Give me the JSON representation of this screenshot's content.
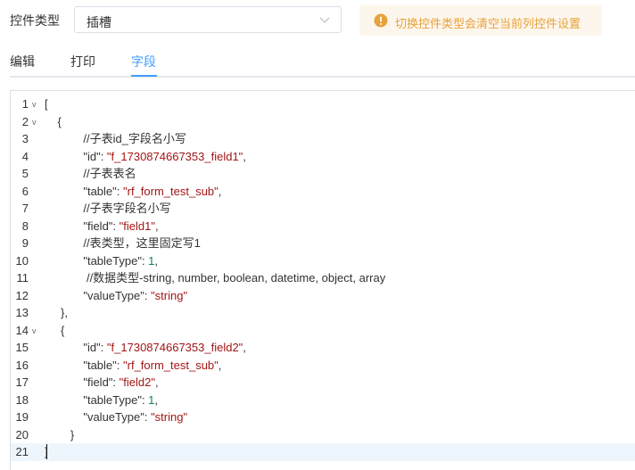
{
  "form": {
    "control_type_label": "控件类型",
    "control_type_value": "插槽",
    "warning_text": "切换控件类型会清空当前列控件设置"
  },
  "tabs": [
    {
      "label": "编辑",
      "active": false
    },
    {
      "label": "打印",
      "active": false
    },
    {
      "label": "字段",
      "active": true
    }
  ],
  "editor": {
    "active_line": 21,
    "lines": [
      {
        "n": "1",
        "fold": true,
        "tokens": [
          {
            "t": "[",
            "k": "p"
          }
        ]
      },
      {
        "n": "2",
        "fold": true,
        "tokens": [
          {
            "t": "    {",
            "k": "p"
          }
        ]
      },
      {
        "n": "3",
        "fold": false,
        "tokens": [
          {
            "t": "            //子表id_字段名小写",
            "k": "c"
          }
        ]
      },
      {
        "n": "4",
        "fold": false,
        "tokens": [
          {
            "t": "            \"id\": ",
            "k": "p"
          },
          {
            "t": "\"f_1730874667353_field1\"",
            "k": "s"
          },
          {
            "t": ",",
            "k": "p"
          }
        ]
      },
      {
        "n": "5",
        "fold": false,
        "tokens": [
          {
            "t": "            //子表表名",
            "k": "c"
          }
        ]
      },
      {
        "n": "6",
        "fold": false,
        "tokens": [
          {
            "t": "            \"table\": ",
            "k": "p"
          },
          {
            "t": "\"rf_form_test_sub\"",
            "k": "s"
          },
          {
            "t": ",",
            "k": "p"
          }
        ]
      },
      {
        "n": "7",
        "fold": false,
        "tokens": [
          {
            "t": "            //子表字段名小写",
            "k": "c"
          }
        ]
      },
      {
        "n": "8",
        "fold": false,
        "tokens": [
          {
            "t": "            \"field\": ",
            "k": "p"
          },
          {
            "t": "\"field1\"",
            "k": "s"
          },
          {
            "t": ",",
            "k": "p"
          }
        ]
      },
      {
        "n": "9",
        "fold": false,
        "tokens": [
          {
            "t": "            //表类型，这里固定写1",
            "k": "c"
          }
        ]
      },
      {
        "n": "10",
        "fold": false,
        "tokens": [
          {
            "t": "            \"tableType\": ",
            "k": "p"
          },
          {
            "t": "1",
            "k": "n"
          },
          {
            "t": ",",
            "k": "p"
          }
        ]
      },
      {
        "n": "11",
        "fold": false,
        "tokens": [
          {
            "t": "             //数据类型-string, number, boolean, datetime, object, array",
            "k": "c"
          }
        ]
      },
      {
        "n": "12",
        "fold": false,
        "tokens": [
          {
            "t": "            \"valueType\": ",
            "k": "p"
          },
          {
            "t": "\"string\"",
            "k": "s"
          }
        ]
      },
      {
        "n": "13",
        "fold": false,
        "tokens": [
          {
            "t": "     },",
            "k": "p"
          }
        ]
      },
      {
        "n": "14",
        "fold": true,
        "tokens": [
          {
            "t": "     {",
            "k": "p"
          }
        ]
      },
      {
        "n": "15",
        "fold": false,
        "tokens": [
          {
            "t": "            \"id\": ",
            "k": "p"
          },
          {
            "t": "\"f_1730874667353_field2\"",
            "k": "s"
          },
          {
            "t": ",",
            "k": "p"
          }
        ]
      },
      {
        "n": "16",
        "fold": false,
        "tokens": [
          {
            "t": "            \"table\": ",
            "k": "p"
          },
          {
            "t": "\"rf_form_test_sub\"",
            "k": "s"
          },
          {
            "t": ",",
            "k": "p"
          }
        ]
      },
      {
        "n": "17",
        "fold": false,
        "tokens": [
          {
            "t": "            \"field\": ",
            "k": "p"
          },
          {
            "t": "\"field2\"",
            "k": "s"
          },
          {
            "t": ",",
            "k": "p"
          }
        ]
      },
      {
        "n": "18",
        "fold": false,
        "tokens": [
          {
            "t": "            \"tableType\": ",
            "k": "p"
          },
          {
            "t": "1",
            "k": "n"
          },
          {
            "t": ",",
            "k": "p"
          }
        ]
      },
      {
        "n": "19",
        "fold": false,
        "tokens": [
          {
            "t": "            \"valueType\": ",
            "k": "p"
          },
          {
            "t": "\"string\"",
            "k": "s"
          }
        ]
      },
      {
        "n": "20",
        "fold": false,
        "tokens": [
          {
            "t": "        }",
            "k": "p"
          }
        ]
      },
      {
        "n": "21",
        "fold": false,
        "tokens": [
          {
            "t": "]",
            "k": "p"
          }
        ]
      }
    ]
  },
  "colors": {
    "accent": "#409eff",
    "warning": "#e6a23c",
    "warning_bg": "#fdf6ec",
    "string": "#a31515",
    "number": "#098658",
    "active_line_bg": "#eef6fd"
  },
  "icons": {
    "warning": "warning-circle-icon",
    "select_arrow": "chevron-down-icon",
    "fold": "fold-arrow-icon"
  }
}
